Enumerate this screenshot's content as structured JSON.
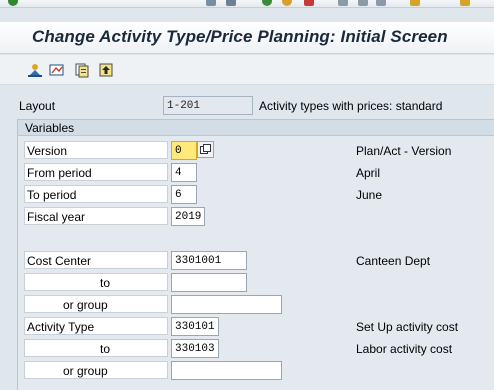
{
  "window": {
    "title": "Change Activity Type/Price Planning: Initial Screen"
  },
  "toolbar_icons": [
    "enter-icon",
    "save-icon",
    "back-icon",
    "exit-icon",
    "cancel-icon",
    "print-icon",
    "find-icon",
    "find-next-icon",
    "first-page-icon",
    "previous-page-icon",
    "next-page-icon"
  ],
  "app_toolbar": {
    "icons": [
      "overview-screen-icon",
      "form-screen-icon",
      "copy-icon",
      "upload-icon"
    ]
  },
  "layout": {
    "label": "Layout",
    "value": "1-201",
    "description": "Activity types with prices: standard"
  },
  "variables": {
    "title": "Variables",
    "version": {
      "label": "Version",
      "value": "0",
      "description": "Plan/Act - Version"
    },
    "from_period": {
      "label": "From period",
      "value": "4",
      "description": "April"
    },
    "to_period": {
      "label": "To period",
      "value": "6",
      "description": "June"
    },
    "fiscal_year": {
      "label": "Fiscal year",
      "value": "2019"
    },
    "cost_center": {
      "label": "Cost Center",
      "value": "3301001",
      "description": "Canteen Dept",
      "to_label": "to",
      "to_value": "",
      "group_label": "or group",
      "group_value": ""
    },
    "activity_type": {
      "label": "Activity Type",
      "value": "330101",
      "description": "Set Up activity cost",
      "to_label": "to",
      "to_value": "330103",
      "to_description": "Labor activity cost",
      "group_label": "or group",
      "group_value": ""
    }
  },
  "colors": {
    "background": "#dfe6ec",
    "title_text": "#1a2a3c",
    "focus_field": "#ffe97a"
  }
}
